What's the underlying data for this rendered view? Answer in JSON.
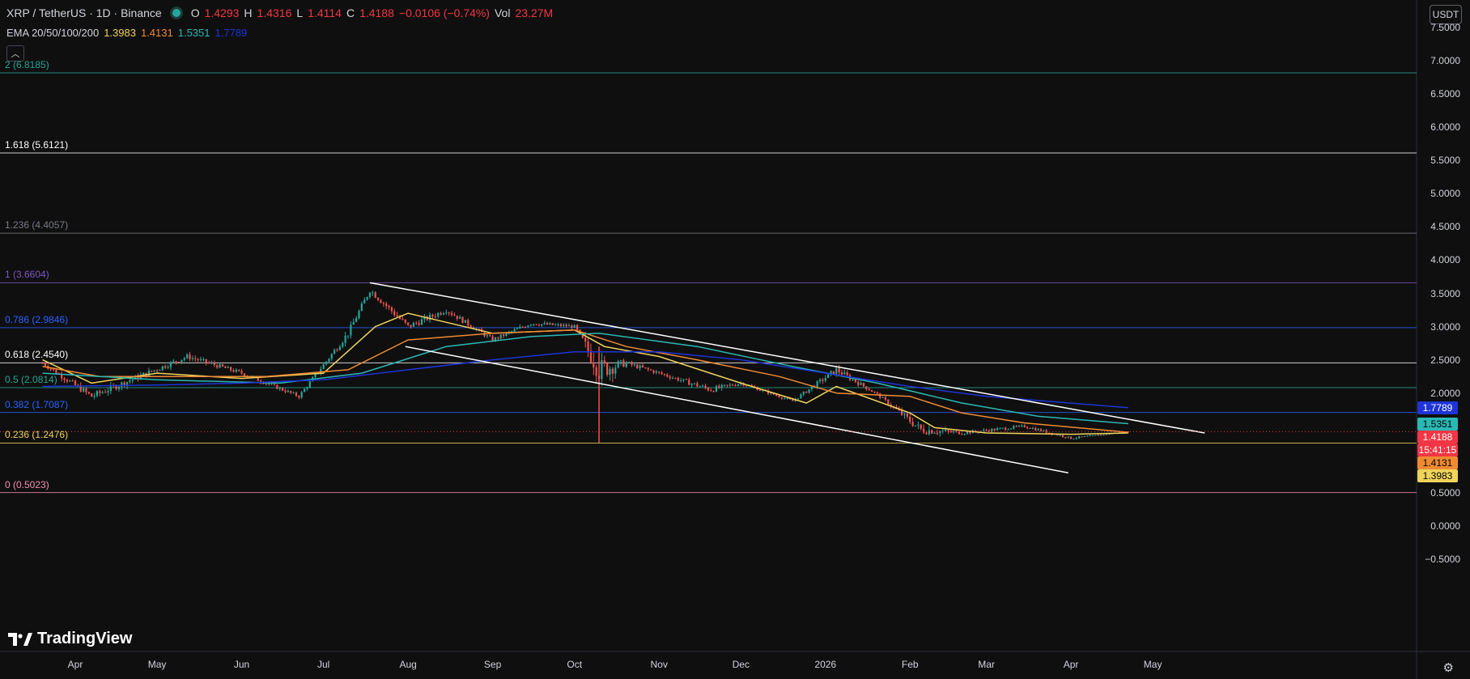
{
  "header": {
    "symbol": "XRP / TetherUS · 1D · Binance",
    "o_label": "O",
    "o": "1.4293",
    "h_label": "H",
    "h": "1.4316",
    "l_label": "L",
    "l": "1.4114",
    "c_label": "C",
    "c": "1.4188",
    "change": "−0.0106 (−0.74%)",
    "vol_label": "Vol",
    "vol": "23.27M"
  },
  "indicator": {
    "name": "EMA 20/50/100/200",
    "v20": "1.3983",
    "v50": "1.4131",
    "v100": "1.5351",
    "v200": "1.7789"
  },
  "currency_button": "USDT",
  "logo_text": "TradingView",
  "colors": {
    "ema20": "#f0d35b",
    "ema50": "#f08a32",
    "ema100": "#2ab8b5",
    "ema200": "#1e34d8",
    "up": "#26a69a",
    "down": "#ef5350",
    "channel": "#ffffff"
  },
  "fib_levels": [
    {
      "label": "2 (6.8185)",
      "price": 6.8185,
      "color": "#26a69a"
    },
    {
      "label": "1.618 (5.6121)",
      "price": 5.6121,
      "color": "#ffffff"
    },
    {
      "label": "1.236 (4.4057)",
      "price": 4.4057,
      "color": "#787b86"
    },
    {
      "label": "1 (3.6604)",
      "price": 3.6604,
      "color": "#7e57c2"
    },
    {
      "label": "0.786 (2.9846)",
      "price": 2.9846,
      "color": "#2962ff"
    },
    {
      "label": "0.618 (2.4540)",
      "price": 2.454,
      "color": "#ffffff"
    },
    {
      "label": "0.5 (2.0814)",
      "price": 2.0814,
      "color": "#26a69a"
    },
    {
      "label": "0.382 (1.7087)",
      "price": 1.7087,
      "color": "#2962ff"
    },
    {
      "label": "0.236 (1.2476)",
      "price": 1.2476,
      "color": "#f0d35b"
    },
    {
      "label": "0 (0.5023)",
      "price": 0.5023,
      "color": "#f48fb1"
    }
  ],
  "y_axis": {
    "min": -0.5,
    "max": 7.5,
    "ticks": [
      "7.5000",
      "7.0000",
      "6.5000",
      "6.0000",
      "5.5000",
      "5.0000",
      "4.5000",
      "4.0000",
      "3.5000",
      "3.0000",
      "2.5000",
      "2.0000",
      "0.5000",
      "0.0000",
      "−0.5000"
    ]
  },
  "x_axis": {
    "labels": [
      "Apr",
      "May",
      "Jun",
      "Jul",
      "Aug",
      "Sep",
      "Oct",
      "Nov",
      "Dec",
      "2026",
      "Feb",
      "Mar",
      "Apr",
      "May"
    ]
  },
  "price_tags": [
    {
      "text": "1.7789",
      "bg": "#1e34d8",
      "fg": "#ffffff"
    },
    {
      "text": "1.5351",
      "bg": "#2ab8b5",
      "fg": "#000000"
    },
    {
      "text": "1.4188",
      "bg": "#f23645",
      "fg": "#ffffff"
    },
    {
      "text": "15:41:15",
      "bg": "#f23645",
      "fg": "#ffffff"
    },
    {
      "text": "1.4131",
      "bg": "#f08a32",
      "fg": "#000000"
    },
    {
      "text": "1.3983",
      "bg": "#f0d35b",
      "fg": "#000000"
    }
  ],
  "chart_data": {
    "type": "line",
    "series": [
      {
        "name": "EMA 20",
        "x": [
          "2025-03-20",
          "2025-04-07",
          "2025-05-01",
          "2025-06-01",
          "2025-07-01",
          "2025-07-20",
          "2025-08-01",
          "2025-09-01",
          "2025-10-01",
          "2025-10-12",
          "2025-11-01",
          "2025-12-01",
          "2025-12-25",
          "2026-01-05",
          "2026-02-01",
          "2026-02-10",
          "2026-03-01",
          "2026-04-01",
          "2026-04-22"
        ],
        "values": [
          2.5,
          2.15,
          2.3,
          2.22,
          2.3,
          3.0,
          3.2,
          2.9,
          2.95,
          2.7,
          2.55,
          2.15,
          1.85,
          2.1,
          1.7,
          1.48,
          1.4,
          1.38,
          1.4
        ]
      },
      {
        "name": "EMA 50",
        "x": [
          "2025-03-20",
          "2025-04-10",
          "2025-05-10",
          "2025-06-10",
          "2025-07-10",
          "2025-08-01",
          "2025-09-01",
          "2025-10-01",
          "2025-10-20",
          "2025-11-15",
          "2025-12-15",
          "2026-01-05",
          "2026-02-01",
          "2026-02-20",
          "2026-03-15",
          "2026-04-22"
        ],
        "values": [
          2.4,
          2.25,
          2.25,
          2.25,
          2.35,
          2.8,
          2.9,
          2.95,
          2.7,
          2.5,
          2.25,
          2.0,
          1.95,
          1.7,
          1.55,
          1.41
        ]
      },
      {
        "name": "EMA 100",
        "x": [
          "2025-03-20",
          "2025-05-01",
          "2025-06-15",
          "2025-07-15",
          "2025-08-15",
          "2025-09-15",
          "2025-10-10",
          "2025-11-15",
          "2025-12-20",
          "2026-01-20",
          "2026-02-20",
          "2026-03-20",
          "2026-04-22"
        ],
        "values": [
          2.3,
          2.2,
          2.15,
          2.3,
          2.7,
          2.85,
          2.9,
          2.7,
          2.4,
          2.15,
          1.85,
          1.65,
          1.54
        ]
      },
      {
        "name": "EMA 200",
        "x": [
          "2025-03-20",
          "2025-05-01",
          "2025-06-01",
          "2025-07-01",
          "2025-08-01",
          "2025-09-01",
          "2025-10-01",
          "2025-11-01",
          "2025-12-01",
          "2026-01-01",
          "2026-02-01",
          "2026-03-01",
          "2026-04-22"
        ],
        "values": [
          2.1,
          2.12,
          2.15,
          2.2,
          2.35,
          2.5,
          2.62,
          2.62,
          2.5,
          2.3,
          2.1,
          1.95,
          1.78
        ]
      }
    ],
    "candles_sample": {
      "x": [
        "2025-03-20",
        "2025-04-07",
        "2025-05-12",
        "2025-06-01",
        "2025-06-22",
        "2025-07-10",
        "2025-07-18",
        "2025-08-01",
        "2025-08-15",
        "2025-09-01",
        "2025-09-15",
        "2025-10-01",
        "2025-10-10",
        "2025-10-20",
        "2025-11-01",
        "2025-11-20",
        "2025-12-01",
        "2025-12-20",
        "2026-01-05",
        "2026-01-20",
        "2026-02-05",
        "2026-02-20",
        "2026-03-15",
        "2026-04-01",
        "2026-04-22"
      ],
      "close": [
        2.45,
        1.95,
        2.55,
        2.3,
        1.95,
        2.9,
        3.55,
        3.0,
        3.25,
        2.8,
        3.05,
        3.0,
        2.35,
        2.45,
        2.3,
        2.05,
        2.15,
        1.88,
        2.35,
        1.98,
        1.45,
        1.4,
        1.5,
        1.32,
        1.42
      ],
      "low": [
        2.3,
        1.7,
        2.35,
        2.15,
        1.85,
        2.6,
        3.3,
        2.75,
        3.05,
        2.7,
        2.9,
        2.9,
        1.25,
        2.3,
        2.2,
        1.82,
        2.05,
        1.8,
        2.05,
        1.9,
        1.1,
        1.32,
        1.38,
        1.28,
        1.41
      ],
      "high": [
        2.55,
        2.1,
        2.65,
        2.4,
        2.05,
        3.0,
        3.66,
        3.15,
        3.35,
        2.95,
        3.15,
        3.1,
        2.7,
        2.6,
        2.4,
        2.15,
        2.25,
        1.95,
        2.42,
        2.05,
        1.65,
        1.5,
        1.55,
        1.4,
        1.44
      ]
    },
    "channel": {
      "upper": {
        "x": [
          "2025-07-18",
          "2026-05-20"
        ],
        "y": [
          3.66,
          1.4
        ]
      },
      "lower": {
        "x": [
          "2025-07-31",
          "2026-03-31"
        ],
        "y": [
          2.7,
          0.8
        ]
      }
    },
    "ylim": [
      -0.5,
      7.5
    ]
  }
}
